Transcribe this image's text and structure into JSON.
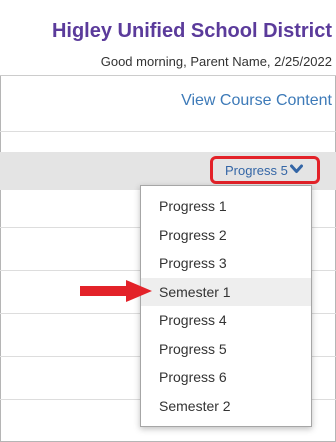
{
  "header": {
    "district_name": "Higley Unified School District",
    "greeting": "Good morning, Parent Name, 2/25/2022"
  },
  "course_link": "View Course Content",
  "grading_period": {
    "selected": "Progress 5",
    "options": [
      "Progress 1",
      "Progress 2",
      "Progress 3",
      "Semester 1",
      "Progress 4",
      "Progress 5",
      "Progress 6",
      "Semester 2"
    ],
    "highlighted": "Semester 1"
  },
  "colors": {
    "district_purple": "#5b3b9b",
    "link_blue": "#3d7ab8",
    "callout_red": "#e32229"
  },
  "icons": {
    "dropdown": "chevron-down-icon",
    "pointer": "arrow-right-icon"
  }
}
